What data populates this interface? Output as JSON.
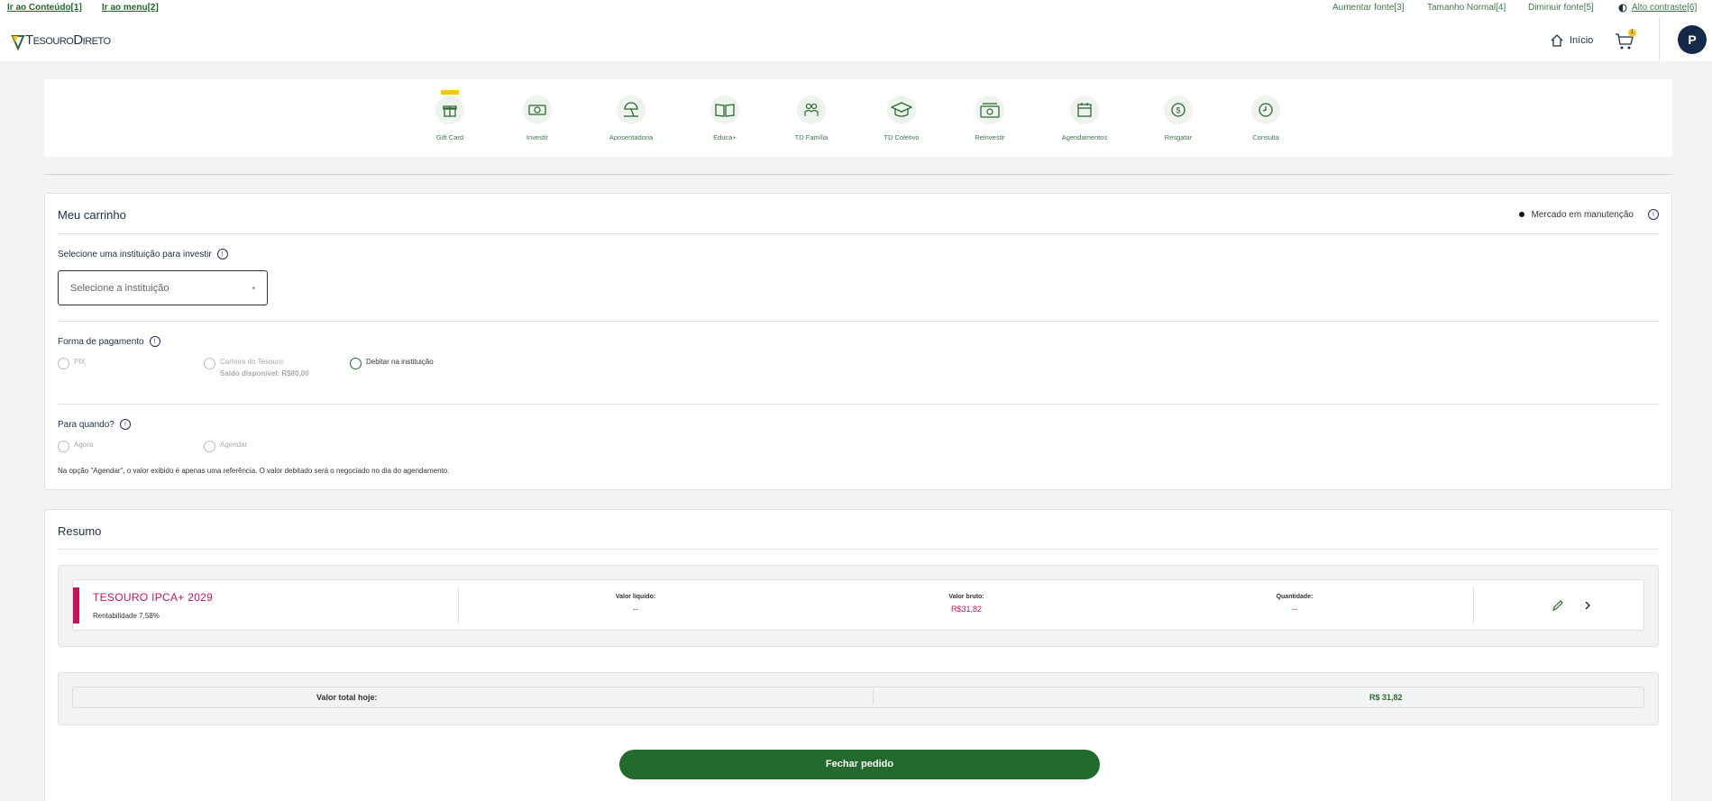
{
  "skip_links": {
    "content": "Ir ao Conteúdo[1]",
    "menu": "Ir ao menu[2]"
  },
  "accessibility": {
    "increase": "Aumentar fonte[3]",
    "normal": "Tamanho Normal[4]",
    "decrease": "Diminuir fonte[5]",
    "contrast": "Alto contraste[6]"
  },
  "header": {
    "logo": "TesouroDireto",
    "home": "Início",
    "cart_count": "1",
    "avatar": "P"
  },
  "menu": {
    "items": [
      {
        "label": "Gift Card",
        "icon": "gift-icon"
      },
      {
        "label": "Investir",
        "icon": "money-icon"
      },
      {
        "label": "Aposentadoria",
        "icon": "beach-umbrella-icon"
      },
      {
        "label": "Educa+",
        "icon": "book-icon"
      },
      {
        "label": "TD Família",
        "icon": "family-icon"
      },
      {
        "label": "TD Coletivo",
        "icon": "graduation-cap-icon"
      },
      {
        "label": "Reinvestir",
        "icon": "reinvest-icon"
      },
      {
        "label": "Agendamentos",
        "icon": "calendar-icon"
      },
      {
        "label": "Resgatar",
        "icon": "dollar-coin-icon"
      },
      {
        "label": "Consulta",
        "icon": "clock-icon"
      }
    ]
  },
  "cart": {
    "title": "Meu carrinho",
    "status": "Mercado em manutenção",
    "institution_label": "Selecione uma instituição para investir",
    "institution_placeholder": "Selecione a instituição",
    "payment_label": "Forma de pagamento",
    "payment_options": [
      "PIX",
      "Carteira do Tesouro",
      "Debitar na instituição"
    ],
    "balance": "Saldo disponível: R$80,00",
    "when_label": "Para quando?",
    "when_options": [
      "Agora",
      "Agendar"
    ],
    "note": "Na opção \"Agendar\", o valor exibido é apenas uma referência. O valor debitado será o negociado no dia do agendamento."
  },
  "summary": {
    "title": "Resumo",
    "product": {
      "name": "TESOURO IPCA+ 2029",
      "rent": "Rentabilidade 7,58%",
      "net_label": "Valor líquido:",
      "net_value": "--",
      "gross_label": "Valor bruto:",
      "gross_value": "R$31,82",
      "qty_label": "Quantidade:",
      "qty_value": "--"
    },
    "total_label": "Valor total hoje:",
    "total_value": "R$ 31,82",
    "button": "Fechar pedido"
  },
  "colors": {
    "green": "#236b2d",
    "navy": "#15294b",
    "magenta": "#c4145b",
    "yellow": "#f5c518"
  }
}
